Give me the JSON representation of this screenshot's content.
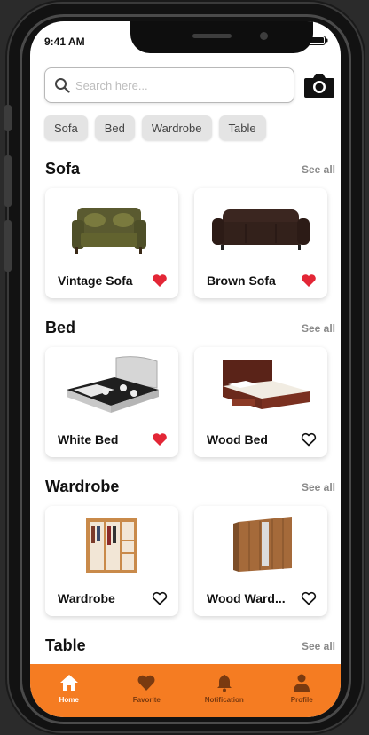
{
  "status_bar": {
    "time": "9:41 AM"
  },
  "search": {
    "placeholder": "Search here..."
  },
  "categories": [
    "Sofa",
    "Bed",
    "Wardrobe",
    "Table"
  ],
  "see_all_label": "See all",
  "sections": [
    {
      "title": "Sofa",
      "items": [
        {
          "name": "Vintage Sofa",
          "favorite": true,
          "image_icon": "vintage-sofa-image"
        },
        {
          "name": "Brown Sofa",
          "favorite": true,
          "image_icon": "brown-sofa-image"
        }
      ]
    },
    {
      "title": "Bed",
      "items": [
        {
          "name": "White Bed",
          "favorite": true,
          "image_icon": "white-bed-image"
        },
        {
          "name": "Wood Bed",
          "favorite": false,
          "image_icon": "wood-bed-image"
        }
      ]
    },
    {
      "title": "Wardrobe",
      "items": [
        {
          "name": "Wardrobe",
          "favorite": false,
          "image_icon": "open-wardrobe-image"
        },
        {
          "name": "Wood Ward...",
          "favorite": false,
          "image_icon": "wood-wardrobe-image"
        }
      ]
    },
    {
      "title": "Table",
      "items": []
    }
  ],
  "bottom_nav": [
    {
      "label": "Home",
      "icon": "home-icon",
      "active": true
    },
    {
      "label": "Favorite",
      "icon": "heart-icon",
      "active": false
    },
    {
      "label": "Notification",
      "icon": "bell-icon",
      "active": false
    },
    {
      "label": "Profile",
      "icon": "person-icon",
      "active": false
    }
  ],
  "colors": {
    "accent": "#f57c22",
    "heart_active": "#e32636",
    "nav_active_text": "#ffffff",
    "nav_inactive": "#7a3a10"
  }
}
